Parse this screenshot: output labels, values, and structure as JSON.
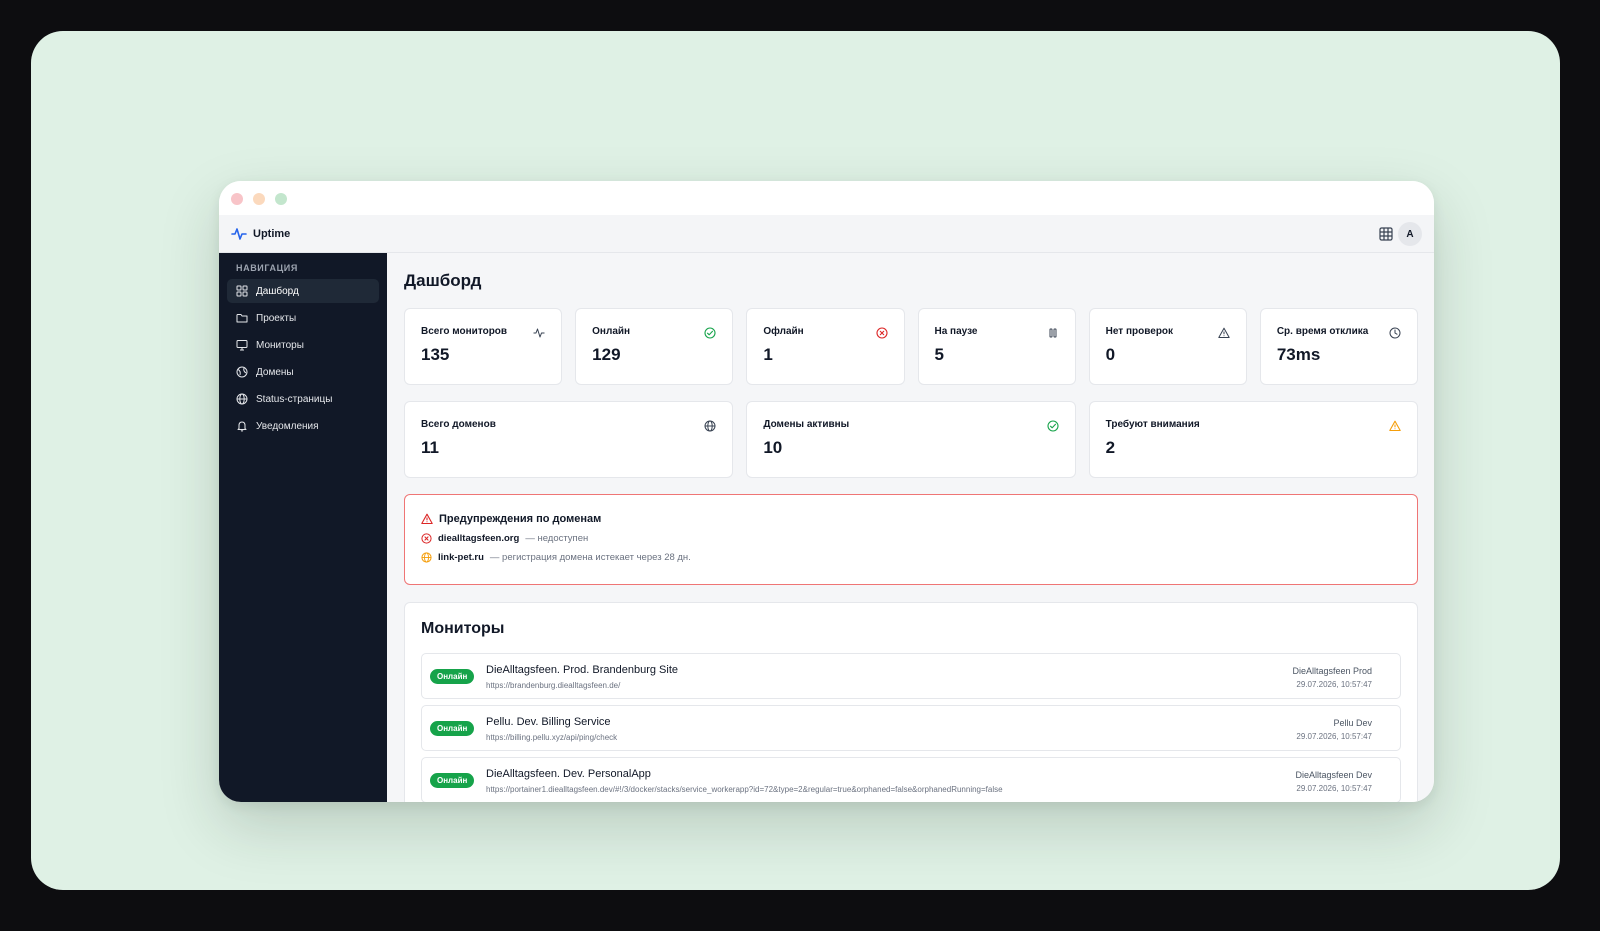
{
  "app": {
    "name": "Uptime",
    "user_initial": "A"
  },
  "sidebar": {
    "heading": "НАВИГАЦИЯ",
    "items": [
      {
        "label": "Дашборд",
        "icon": "dashboard-icon",
        "active": true
      },
      {
        "label": "Проекты",
        "icon": "folder-icon"
      },
      {
        "label": "Мониторы",
        "icon": "monitor-icon"
      },
      {
        "label": "Домены",
        "icon": "domains-icon"
      },
      {
        "label": "Status-страницы",
        "icon": "globe-icon"
      },
      {
        "label": "Уведомления",
        "icon": "bell-icon"
      }
    ]
  },
  "page": {
    "title": "Дашборд"
  },
  "stats": [
    {
      "label": "Всего мониторов",
      "value": "135",
      "icon": "activity-icon"
    },
    {
      "label": "Онлайн",
      "value": "129",
      "icon": "check-circle-icon",
      "color": "#16a34a"
    },
    {
      "label": "Офлайн",
      "value": "1",
      "icon": "x-circle-icon",
      "color": "#dc2626"
    },
    {
      "label": "На паузе",
      "value": "5",
      "icon": "pause-icon"
    },
    {
      "label": "Нет проверок",
      "value": "0",
      "icon": "warning-icon"
    },
    {
      "label": "Ср. время отклика",
      "value": "73ms",
      "icon": "clock-icon"
    }
  ],
  "domain_stats": [
    {
      "label": "Всего доменов",
      "value": "11",
      "icon": "globe-icon"
    },
    {
      "label": "Домены активны",
      "value": "10",
      "icon": "check-circle-icon",
      "color": "#16a34a"
    },
    {
      "label": "Требуют внимания",
      "value": "2",
      "icon": "warning-icon",
      "color": "#f59e0b"
    }
  ],
  "alerts": {
    "title": "Предупреждения по доменам",
    "items": [
      {
        "domain": "diealltagsfeen.org",
        "note": "— недоступен",
        "icon": "x-circle-icon",
        "color": "#dc2626"
      },
      {
        "domain": "link-pet.ru",
        "note": "— регистрация домена истекает через 28 дн.",
        "icon": "globe-icon",
        "color": "#f59e0b"
      }
    ]
  },
  "monitors": {
    "title": "Мониторы",
    "rows": [
      {
        "status": "Онлайн",
        "name": "DieAlltagsfeen. Prod. Brandenburg Site",
        "url": "https://brandenburg.diealltagsfeen.de/",
        "project": "DieAlltagsfeen Prod",
        "time": "29.07.2026, 10:57:47"
      },
      {
        "status": "Онлайн",
        "name": "Pellu. Dev. Billing Service",
        "url": "https://billing.pellu.xyz/api/ping/check",
        "project": "Pellu Dev",
        "time": "29.07.2026, 10:57:47"
      },
      {
        "status": "Онлайн",
        "name": "DieAlltagsfeen. Dev. PersonalApp",
        "url": "https://portainer1.diealltagsfeen.dev/#!/3/docker/stacks/service_workerapp?id=72&type=2&regular=true&orphaned=false&orphanedRunning=false",
        "project": "DieAlltagsfeen Dev",
        "time": "29.07.2026, 10:57:47"
      }
    ]
  }
}
